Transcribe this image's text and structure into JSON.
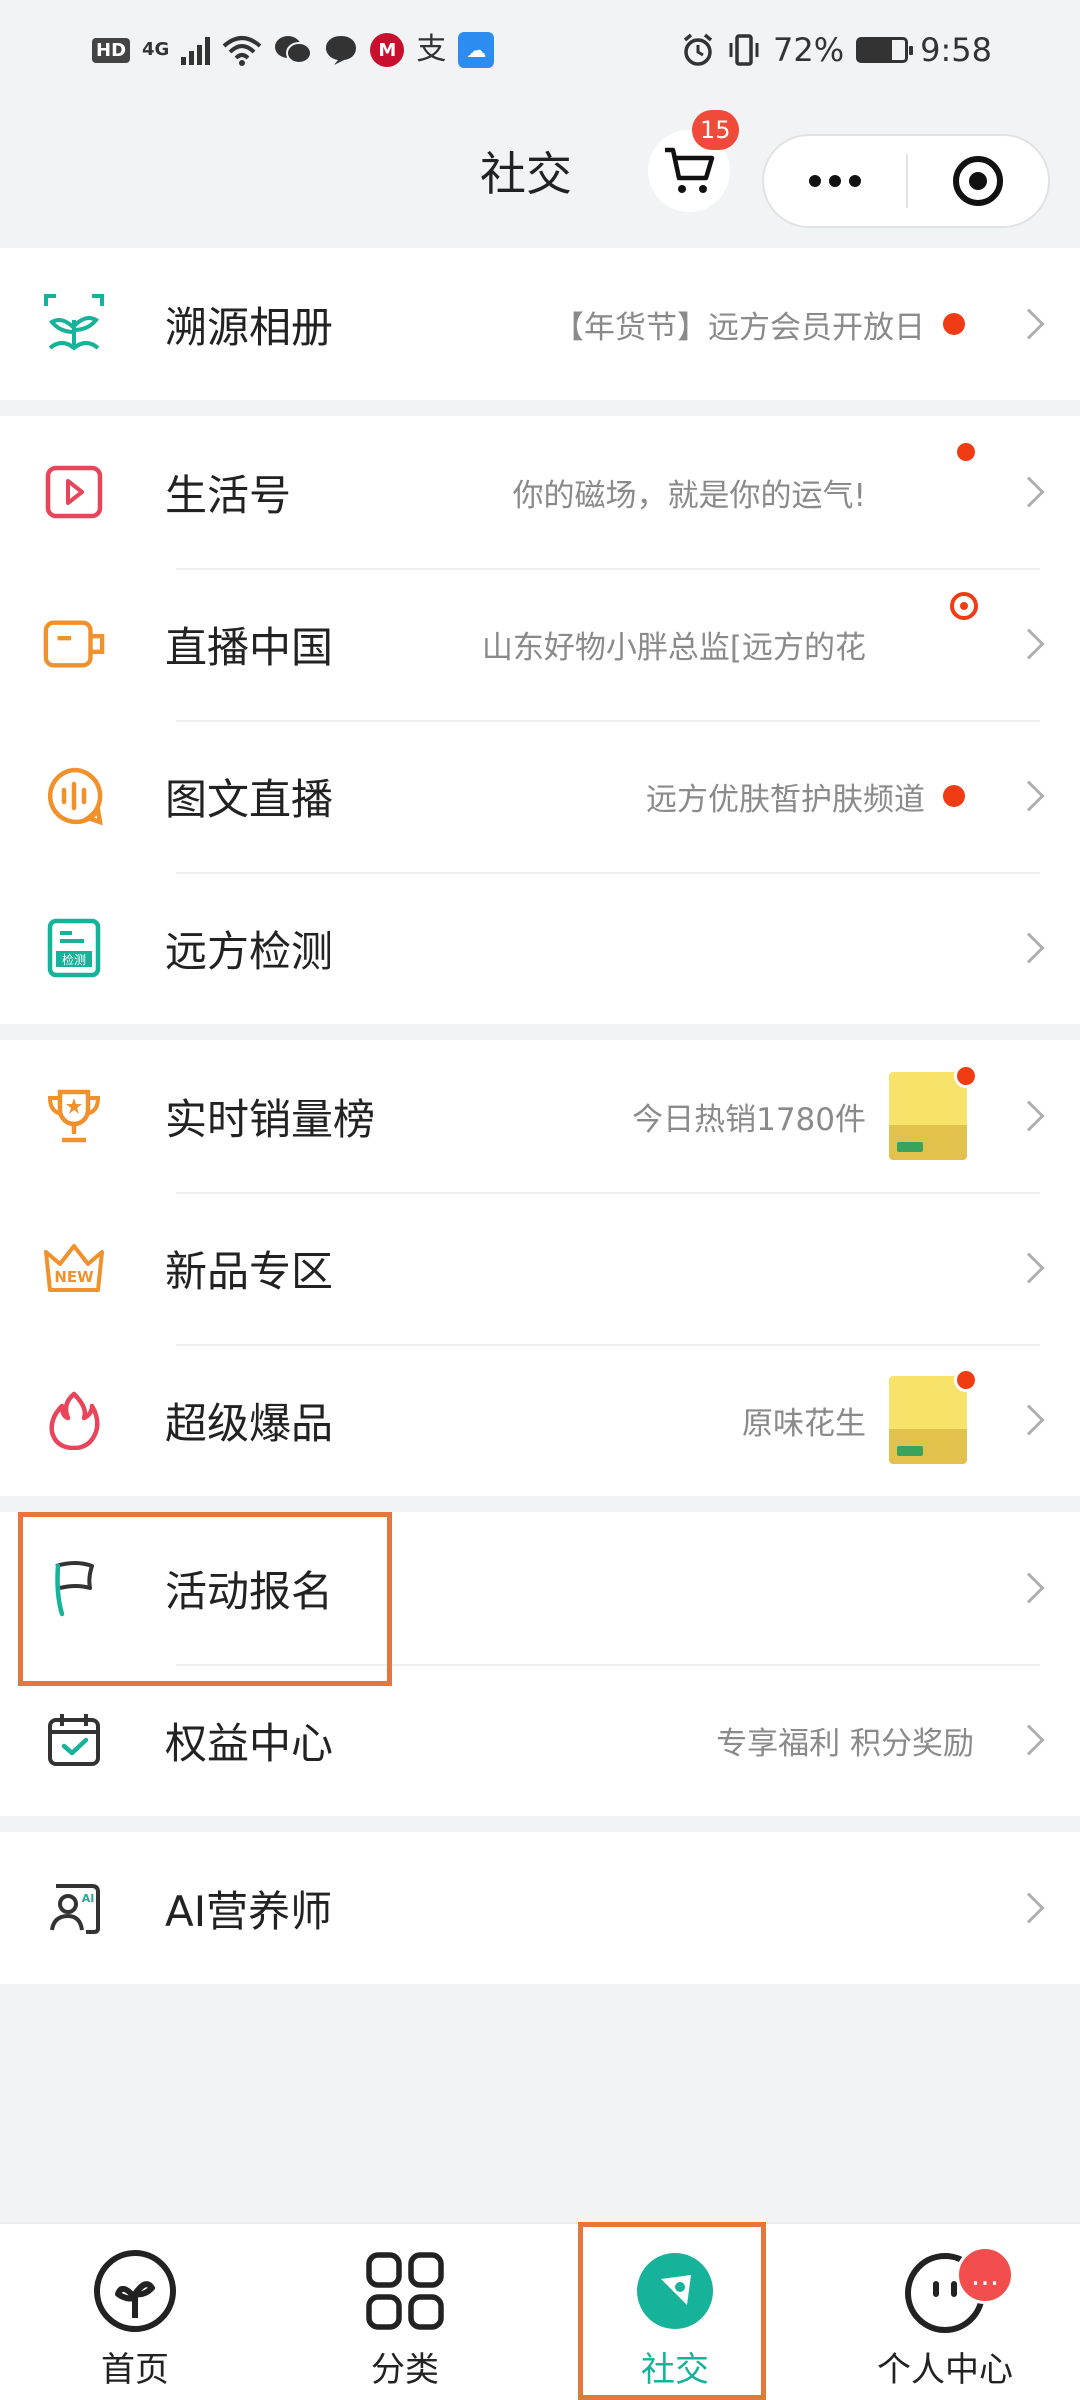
{
  "status_bar": {
    "hd": "HD",
    "network": "4G",
    "battery_percent": "72%",
    "battery_level": 0.72,
    "time": "9:58",
    "carrier_icon": "M",
    "alipay_glyph": "支"
  },
  "header": {
    "title": "社交",
    "cart_badge": "15"
  },
  "menu": {
    "groups": [
      {
        "items": [
          {
            "label": "溯源相册",
            "sub": "【年货节】远方会员开放日",
            "dot": true,
            "icon": "sprout-icon"
          }
        ]
      },
      {
        "items": [
          {
            "label": "生活号",
            "sub": "你的磁场，就是你的运气!",
            "thumb": "avatar",
            "icon": "play-icon"
          },
          {
            "label": "直播中国",
            "sub": "山东好物小胖总监[远方的花",
            "thumb": "food",
            "icon": "camera-icon"
          },
          {
            "label": "图文直播",
            "sub": "远方优肤皙护肤频道",
            "dot": true,
            "icon": "chat-wave-icon"
          },
          {
            "label": "远方检测",
            "sub": "",
            "icon": "report-icon",
            "icon_text": "检测"
          }
        ]
      },
      {
        "items": [
          {
            "label": "实时销量榜",
            "sub": "今日热销1780件",
            "thumb": "pack",
            "icon": "trophy-icon"
          },
          {
            "label": "新品专区",
            "sub": "",
            "icon": "new-crown-icon",
            "icon_text": "NEW"
          },
          {
            "label": "超级爆品",
            "sub": "原味花生",
            "thumb": "pack",
            "icon": "flame-icon"
          }
        ]
      },
      {
        "items": [
          {
            "label": "活动报名",
            "sub": "",
            "icon": "flag-icon"
          },
          {
            "label": "权益中心",
            "sub": "专享福利 积分奖励",
            "icon": "calendar-check-icon"
          }
        ]
      },
      {
        "items": [
          {
            "label": "AI营养师",
            "sub": "",
            "icon": "ai-person-icon",
            "icon_text": "AI"
          }
        ]
      }
    ]
  },
  "tabbar": {
    "tabs": [
      {
        "label": "首页",
        "icon": "sprout-circle-icon"
      },
      {
        "label": "分类",
        "icon": "grid-icon"
      },
      {
        "label": "社交",
        "icon": "compass-icon",
        "active": true
      },
      {
        "label": "个人中心",
        "icon": "face-icon",
        "badge": "..."
      }
    ]
  },
  "colors": {
    "accent": "#16b29a",
    "badge": "#f04a3a",
    "highlight": "#e5763c",
    "dot": "#f03c14"
  }
}
